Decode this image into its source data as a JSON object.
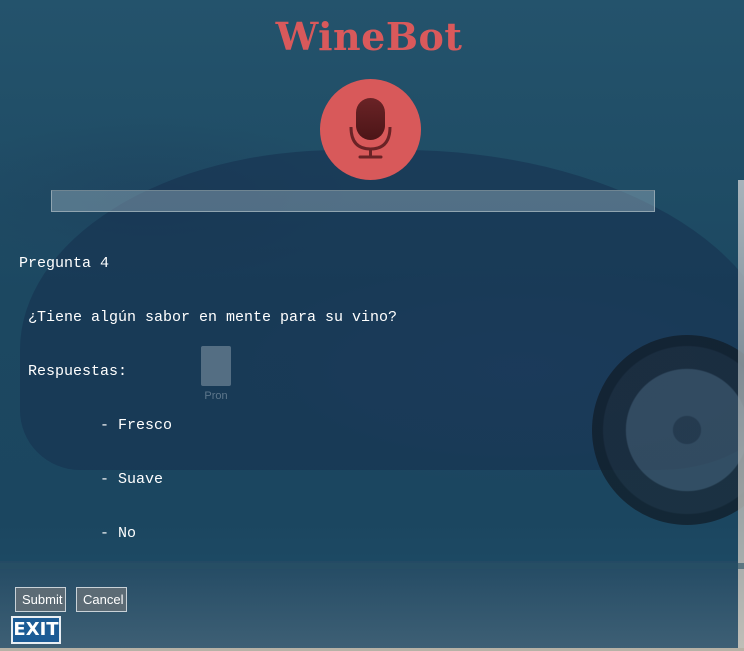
{
  "app": {
    "title": "WineBot"
  },
  "mic": {
    "icon": "microphone-icon",
    "accent": "#d8595a"
  },
  "question": {
    "header": "Pregunta 4",
    "text": " ¿Tiene algún sabor en mente para su vino?",
    "answers_label": " Respuestas:",
    "options": [
      "         - Fresco",
      "         - Suave",
      "         - No"
    ]
  },
  "desktop": {
    "icon_label": "Pron"
  },
  "buttons": {
    "submit": "Submit",
    "cancel": "Cancel",
    "exit": "EXIT"
  },
  "colors": {
    "title": "#d9595b",
    "overlay": "#1d4a62"
  }
}
